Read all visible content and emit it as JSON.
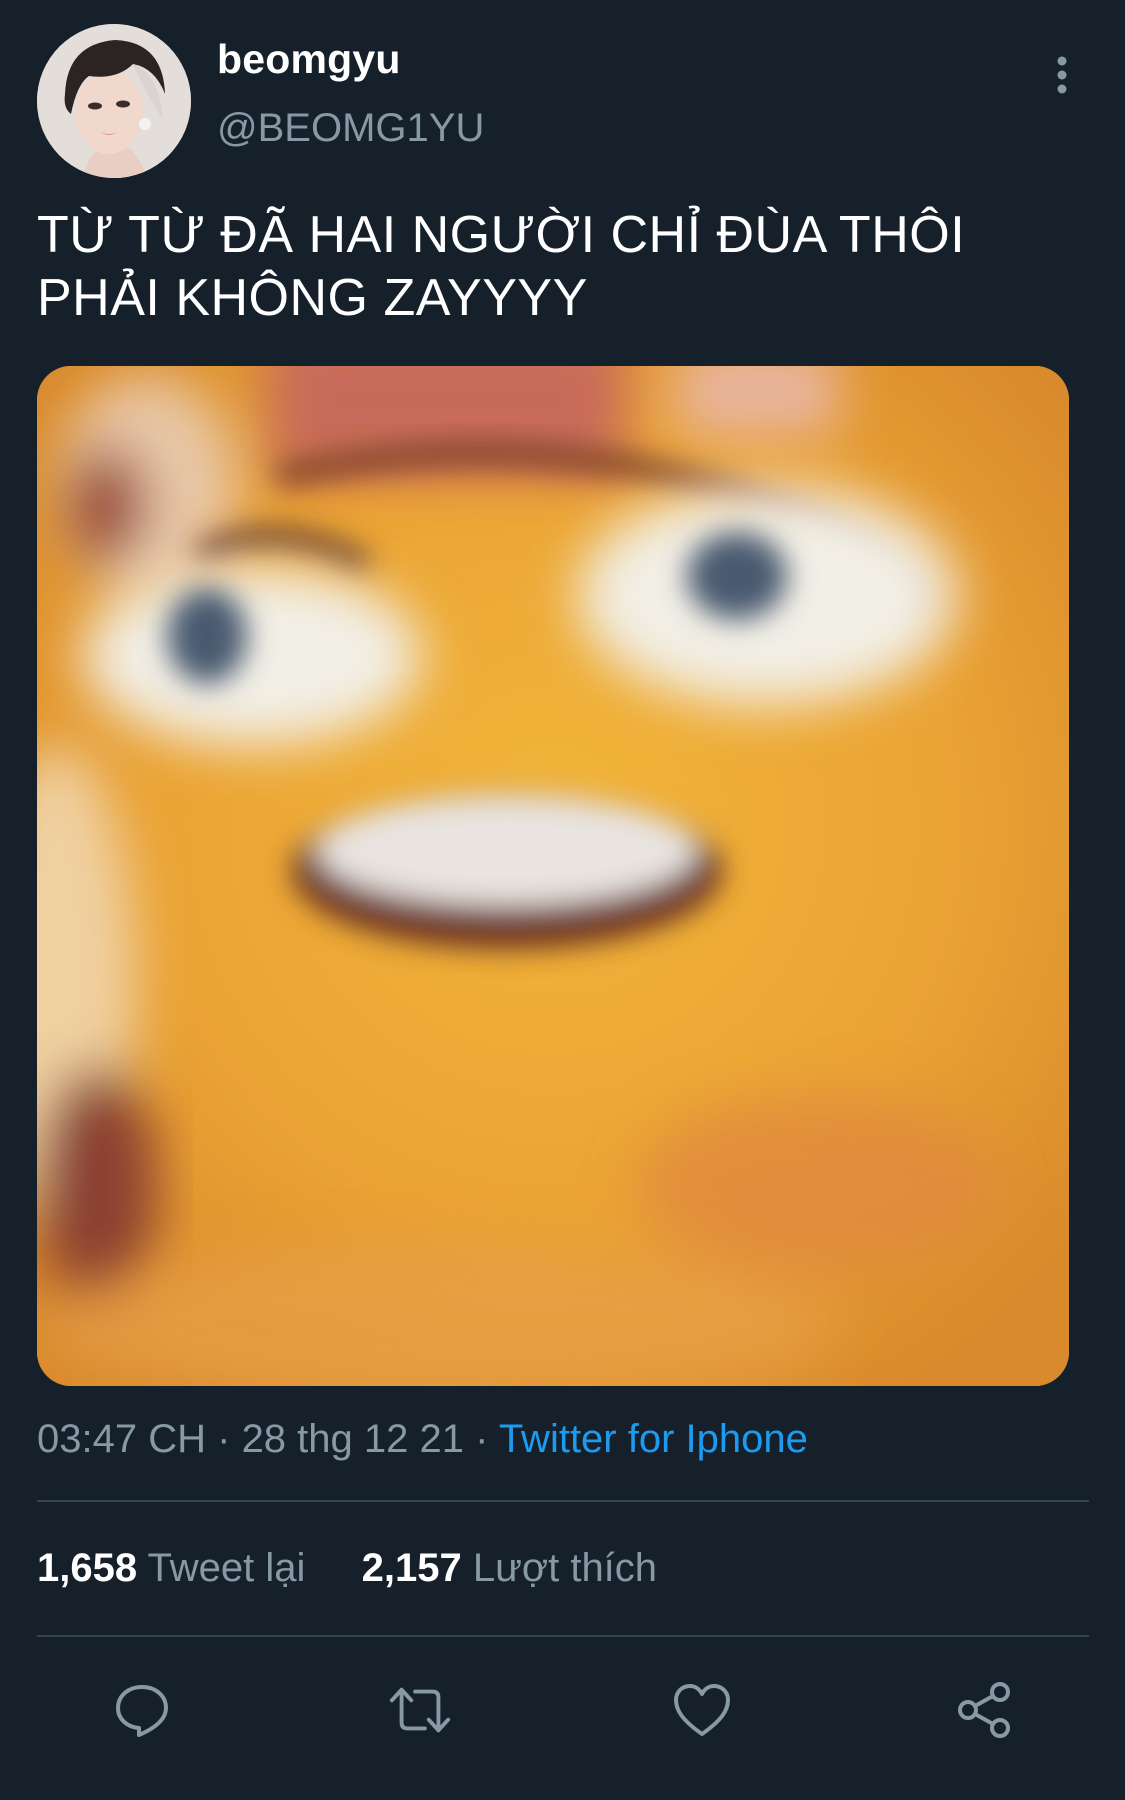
{
  "tweet": {
    "display_name": "beomgyu",
    "handle": "@BEOMG1YU",
    "text_line1": "TỪ TỪ ĐÃ HAI NGƯỜI CHỈ ĐÙA THÔI",
    "text_line2": "PHẢI KHÔNG ZAYYYY",
    "time": "03:47 CH",
    "date": "28 thg 12 21",
    "separator": "·",
    "source": "Twitter for Iphone"
  },
  "stats": {
    "retweets_count": "1,658",
    "retweets_label": "Tweet lại",
    "likes_count": "2,157",
    "likes_label": "Lượt thích"
  },
  "icons": {
    "more": "more-vertical-icon",
    "reply": "reply-icon",
    "retweet": "retweet-icon",
    "like": "heart-icon",
    "share": "share-icon"
  },
  "colors": {
    "background": "#15202b",
    "text_primary": "#ffffff",
    "text_secondary": "#8899a6",
    "accent": "#1d9bf0",
    "divider": "#38444d"
  }
}
